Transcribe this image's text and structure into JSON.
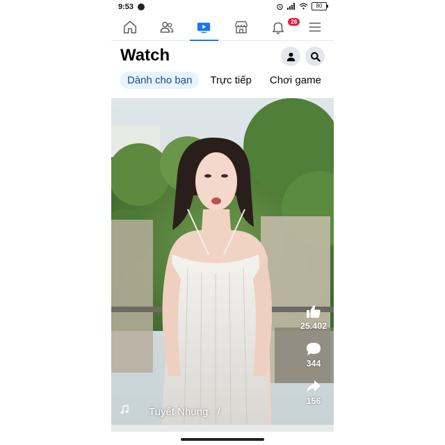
{
  "status": {
    "time": "9:53",
    "battery": "80"
  },
  "nav": {
    "items": [
      {
        "icon": "home-icon"
      },
      {
        "icon": "friends-icon"
      },
      {
        "icon": "watch-icon"
      },
      {
        "icon": "marketplace-icon"
      },
      {
        "icon": "bell-icon",
        "badge": "26"
      },
      {
        "icon": "menu-icon"
      }
    ],
    "active_index": 2,
    "accent": "#1877f2"
  },
  "header": {
    "title": "Watch"
  },
  "tabs": [
    {
      "label": "Dành cho bạn",
      "active": true
    },
    {
      "label": "Trực tiếp"
    },
    {
      "label": "Chơi game"
    }
  ],
  "video": {
    "likes": "25.402",
    "comments": "344",
    "shares": "156",
    "author": "Tuyết Nhung · /"
  }
}
